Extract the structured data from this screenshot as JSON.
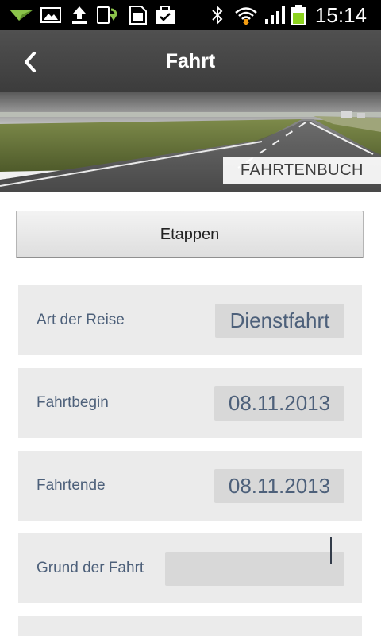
{
  "status_bar": {
    "time": "15:14",
    "icons": [
      "send-icon",
      "gallery-icon",
      "upload-icon",
      "update-icon",
      "sim-icon",
      "briefcase-check-icon",
      "bluetooth-icon",
      "wifi-icon",
      "signal-icon",
      "battery-icon"
    ]
  },
  "app_bar": {
    "back_icon": "chevron-left-icon",
    "title": "Fahrt"
  },
  "banner": {
    "label": "FAHRTENBUCH"
  },
  "etappen_button": {
    "label": "Etappen"
  },
  "form": {
    "rows": [
      {
        "label": "Art der Reise",
        "value": "Dienstfahrt"
      },
      {
        "label": "Fahrtbegin",
        "value": "08.11.2013"
      },
      {
        "label": "Fahrtende",
        "value": "08.11.2013"
      },
      {
        "label": "Grund der Fahrt",
        "value": ""
      }
    ]
  },
  "colors": {
    "status_bar": "#000000",
    "app_bar": "#444444",
    "row_background": "#ebebeb",
    "value_background": "#d8d8d8",
    "text_blue": "#4d607a",
    "battery_green": "#8cd21e"
  }
}
